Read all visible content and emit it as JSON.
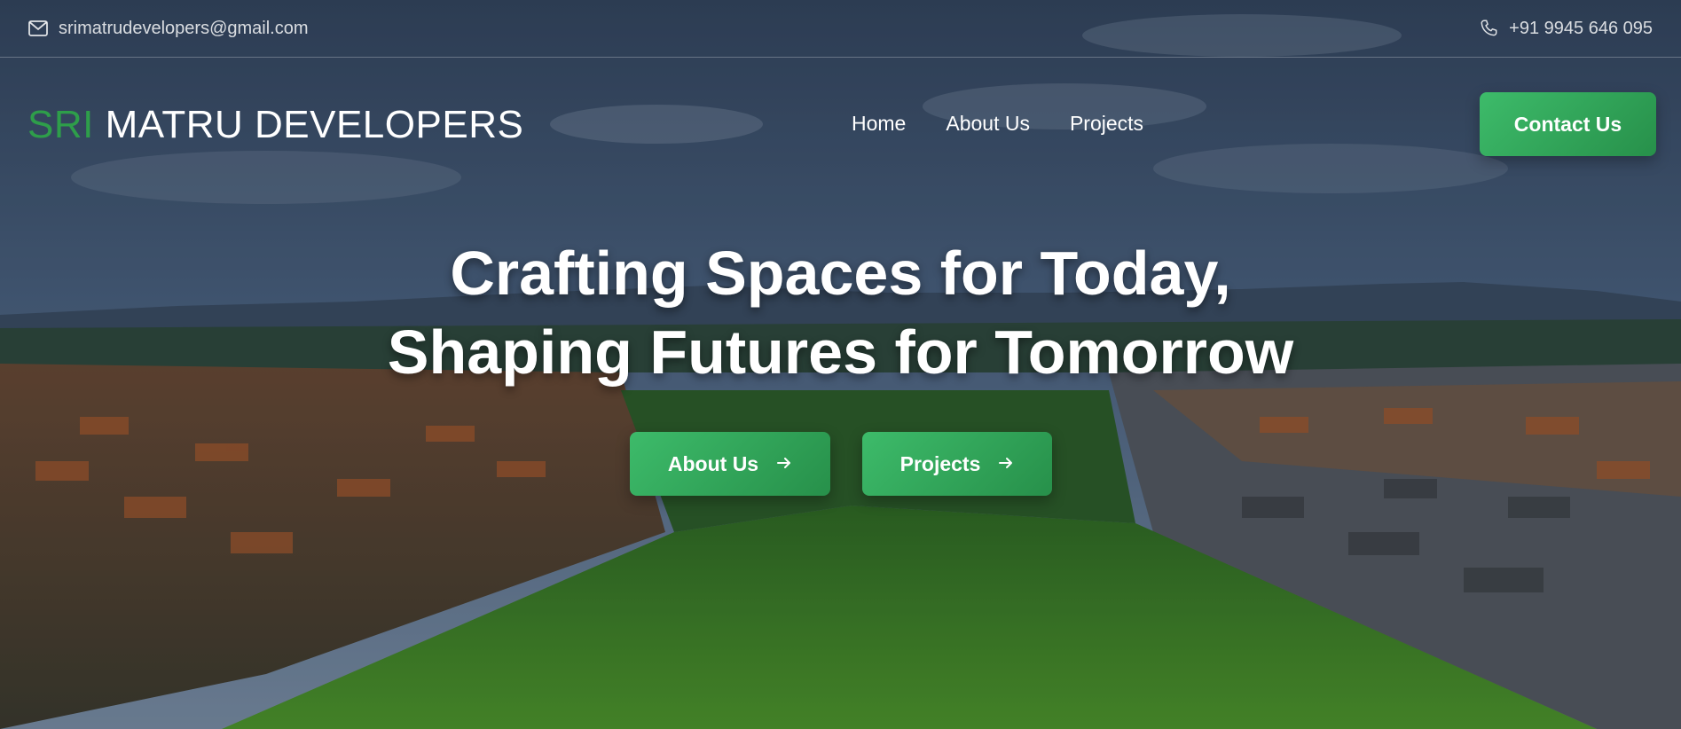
{
  "topbar": {
    "email": "srimatrudevelopers@gmail.com",
    "phone": "+91 9945 646 095",
    "email_icon": "mail-icon",
    "phone_icon": "phone-icon"
  },
  "logo": {
    "accent": "SRI",
    "rest": "MATRU DEVELOPERS"
  },
  "nav": {
    "items": [
      {
        "label": "Home"
      },
      {
        "label": "About Us"
      },
      {
        "label": "Projects"
      }
    ],
    "contact_label": "Contact Us"
  },
  "hero": {
    "line1": "Crafting Spaces for Today,",
    "line2": "Shaping Futures for Tomorrow",
    "buttons": [
      {
        "label": "About Us",
        "icon": "arrow-right-icon"
      },
      {
        "label": "Projects",
        "icon": "arrow-right-icon"
      }
    ]
  },
  "colors": {
    "accent_green": "#2e9e4a",
    "button_green": "#34a85a",
    "text": "#ffffff"
  }
}
